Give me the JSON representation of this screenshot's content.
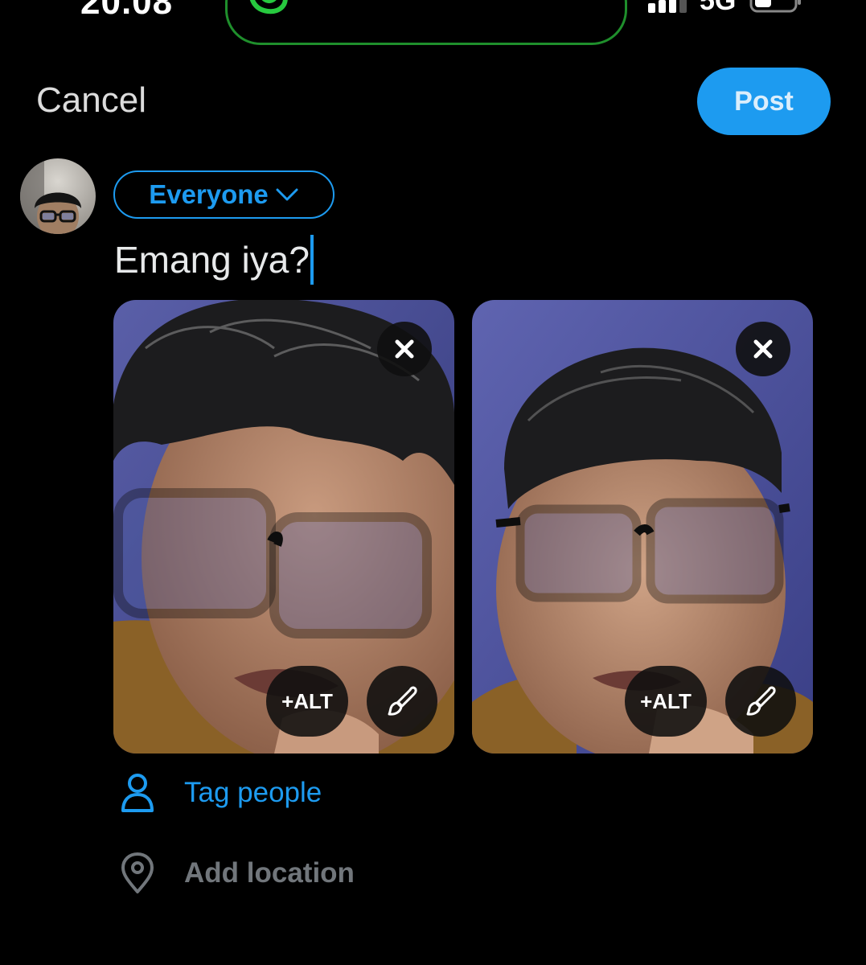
{
  "status_bar": {
    "time": "20.08",
    "network": "5G"
  },
  "header": {
    "cancel_label": "Cancel",
    "post_label": "Post"
  },
  "composer": {
    "audience_label": "Everyone",
    "text": "Emang iya?"
  },
  "media": [
    {
      "alt_label": "+ALT"
    },
    {
      "alt_label": "+ALT"
    }
  ],
  "actions": {
    "tag_people_label": "Tag people",
    "add_location_label": "Add location"
  },
  "icons": {
    "cancel_media": "close-icon",
    "edit_media": "brush-icon",
    "tag_people": "person-icon",
    "add_location": "location-pin-icon",
    "audience": "chevron-down-icon"
  },
  "colors": {
    "accent": "#1d9bf0",
    "background": "#000000",
    "muted": "#71767b",
    "text": "#e7e9ea"
  }
}
